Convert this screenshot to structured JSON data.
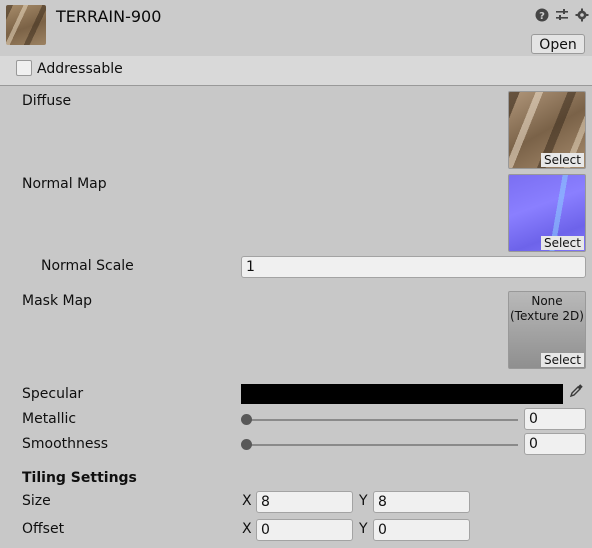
{
  "header": {
    "title": "TERRAIN-900",
    "open_label": "Open",
    "icons": [
      "help-icon",
      "preset-icon",
      "settings-icon"
    ]
  },
  "addressable": {
    "label": "Addressable",
    "checked": false
  },
  "properties": {
    "diffuse": {
      "label": "Diffuse",
      "select_label": "Select"
    },
    "normal_map": {
      "label": "Normal Map",
      "select_label": "Select"
    },
    "normal_scale": {
      "label": "Normal Scale",
      "value": "1"
    },
    "mask_map": {
      "label": "Mask Map",
      "none_line1": "None",
      "none_line2": "(Texture 2D)",
      "select_label": "Select"
    },
    "specular": {
      "label": "Specular",
      "color": "#000000"
    },
    "metallic": {
      "label": "Metallic",
      "value": "0",
      "level": 0
    },
    "smoothness": {
      "label": "Smoothness",
      "value": "0",
      "level": 0
    }
  },
  "tiling": {
    "heading": "Tiling Settings",
    "size": {
      "label": "Size",
      "x_label": "X",
      "x_value": "8",
      "y_label": "Y",
      "y_value": "8"
    },
    "offset": {
      "label": "Offset",
      "x_label": "X",
      "x_value": "0",
      "y_label": "Y",
      "y_value": "0"
    }
  },
  "colors": {
    "background": "#c8c8c8",
    "swatch": "#000000"
  }
}
